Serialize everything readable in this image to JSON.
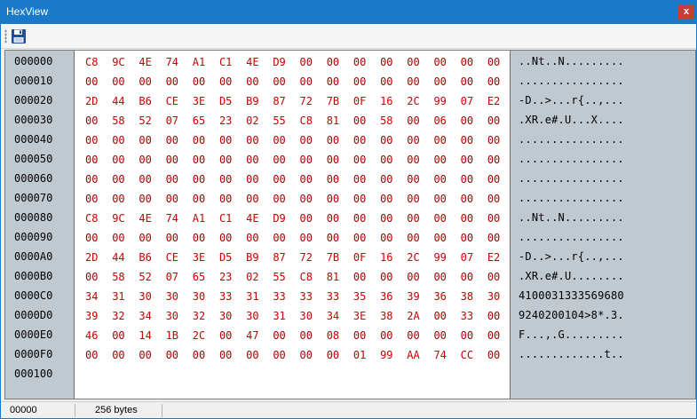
{
  "window": {
    "title": "HexView",
    "close_label": "x"
  },
  "toolbar": {
    "save_icon": "floppy-disk-icon"
  },
  "colors": {
    "titlebar": "#1979ca",
    "hex_nonzero": "#c80000",
    "hex_zero": "#aa0000",
    "panel": "#c0c8d0"
  },
  "rows": [
    {
      "offset": "000000",
      "bytes": [
        "C8",
        "9C",
        "4E",
        "74",
        "A1",
        "C1",
        "4E",
        "D9",
        "00",
        "00",
        "00",
        "00",
        "00",
        "00",
        "00",
        "00"
      ],
      "ascii": "..Nt..N........."
    },
    {
      "offset": "000010",
      "bytes": [
        "00",
        "00",
        "00",
        "00",
        "00",
        "00",
        "00",
        "00",
        "00",
        "00",
        "00",
        "00",
        "00",
        "00",
        "00",
        "00"
      ],
      "ascii": "................"
    },
    {
      "offset": "000020",
      "bytes": [
        "2D",
        "44",
        "B6",
        "CE",
        "3E",
        "D5",
        "B9",
        "87",
        "72",
        "7B",
        "0F",
        "16",
        "2C",
        "99",
        "07",
        "E2"
      ],
      "ascii": "-D..>...r{..,..."
    },
    {
      "offset": "000030",
      "bytes": [
        "00",
        "58",
        "52",
        "07",
        "65",
        "23",
        "02",
        "55",
        "C8",
        "81",
        "00",
        "58",
        "00",
        "06",
        "00",
        "00"
      ],
      "ascii": ".XR.e#.U...X...."
    },
    {
      "offset": "000040",
      "bytes": [
        "00",
        "00",
        "00",
        "00",
        "00",
        "00",
        "00",
        "00",
        "00",
        "00",
        "00",
        "00",
        "00",
        "00",
        "00",
        "00"
      ],
      "ascii": "................"
    },
    {
      "offset": "000050",
      "bytes": [
        "00",
        "00",
        "00",
        "00",
        "00",
        "00",
        "00",
        "00",
        "00",
        "00",
        "00",
        "00",
        "00",
        "00",
        "00",
        "00"
      ],
      "ascii": "................"
    },
    {
      "offset": "000060",
      "bytes": [
        "00",
        "00",
        "00",
        "00",
        "00",
        "00",
        "00",
        "00",
        "00",
        "00",
        "00",
        "00",
        "00",
        "00",
        "00",
        "00"
      ],
      "ascii": "................"
    },
    {
      "offset": "000070",
      "bytes": [
        "00",
        "00",
        "00",
        "00",
        "00",
        "00",
        "00",
        "00",
        "00",
        "00",
        "00",
        "00",
        "00",
        "00",
        "00",
        "00"
      ],
      "ascii": "................"
    },
    {
      "offset": "000080",
      "bytes": [
        "C8",
        "9C",
        "4E",
        "74",
        "A1",
        "C1",
        "4E",
        "D9",
        "00",
        "00",
        "00",
        "00",
        "00",
        "00",
        "00",
        "00"
      ],
      "ascii": "..Nt..N........."
    },
    {
      "offset": "000090",
      "bytes": [
        "00",
        "00",
        "00",
        "00",
        "00",
        "00",
        "00",
        "00",
        "00",
        "00",
        "00",
        "00",
        "00",
        "00",
        "00",
        "00"
      ],
      "ascii": "................"
    },
    {
      "offset": "0000A0",
      "bytes": [
        "2D",
        "44",
        "B6",
        "CE",
        "3E",
        "D5",
        "B9",
        "87",
        "72",
        "7B",
        "0F",
        "16",
        "2C",
        "99",
        "07",
        "E2"
      ],
      "ascii": "-D..>...r{..,..."
    },
    {
      "offset": "0000B0",
      "bytes": [
        "00",
        "58",
        "52",
        "07",
        "65",
        "23",
        "02",
        "55",
        "C8",
        "81",
        "00",
        "00",
        "00",
        "00",
        "00",
        "00"
      ],
      "ascii": ".XR.e#.U........"
    },
    {
      "offset": "0000C0",
      "bytes": [
        "34",
        "31",
        "30",
        "30",
        "30",
        "33",
        "31",
        "33",
        "33",
        "33",
        "35",
        "36",
        "39",
        "36",
        "38",
        "30"
      ],
      "ascii": "4100031333569680"
    },
    {
      "offset": "0000D0",
      "bytes": [
        "39",
        "32",
        "34",
        "30",
        "32",
        "30",
        "30",
        "31",
        "30",
        "34",
        "3E",
        "38",
        "2A",
        "00",
        "33",
        "00"
      ],
      "ascii": "9240200104>8*.3."
    },
    {
      "offset": "0000E0",
      "bytes": [
        "46",
        "00",
        "14",
        "1B",
        "2C",
        "00",
        "47",
        "00",
        "00",
        "08",
        "00",
        "00",
        "00",
        "00",
        "00",
        "00"
      ],
      "ascii": "F...,.G........."
    },
    {
      "offset": "0000F0",
      "bytes": [
        "00",
        "00",
        "00",
        "00",
        "00",
        "00",
        "00",
        "00",
        "00",
        "00",
        "01",
        "99",
        "AA",
        "74",
        "CC",
        "00"
      ],
      "ascii": ".............t.."
    },
    {
      "offset": "000100",
      "bytes": [],
      "ascii": ""
    }
  ],
  "status": {
    "position": "00000",
    "size": "256 bytes"
  }
}
